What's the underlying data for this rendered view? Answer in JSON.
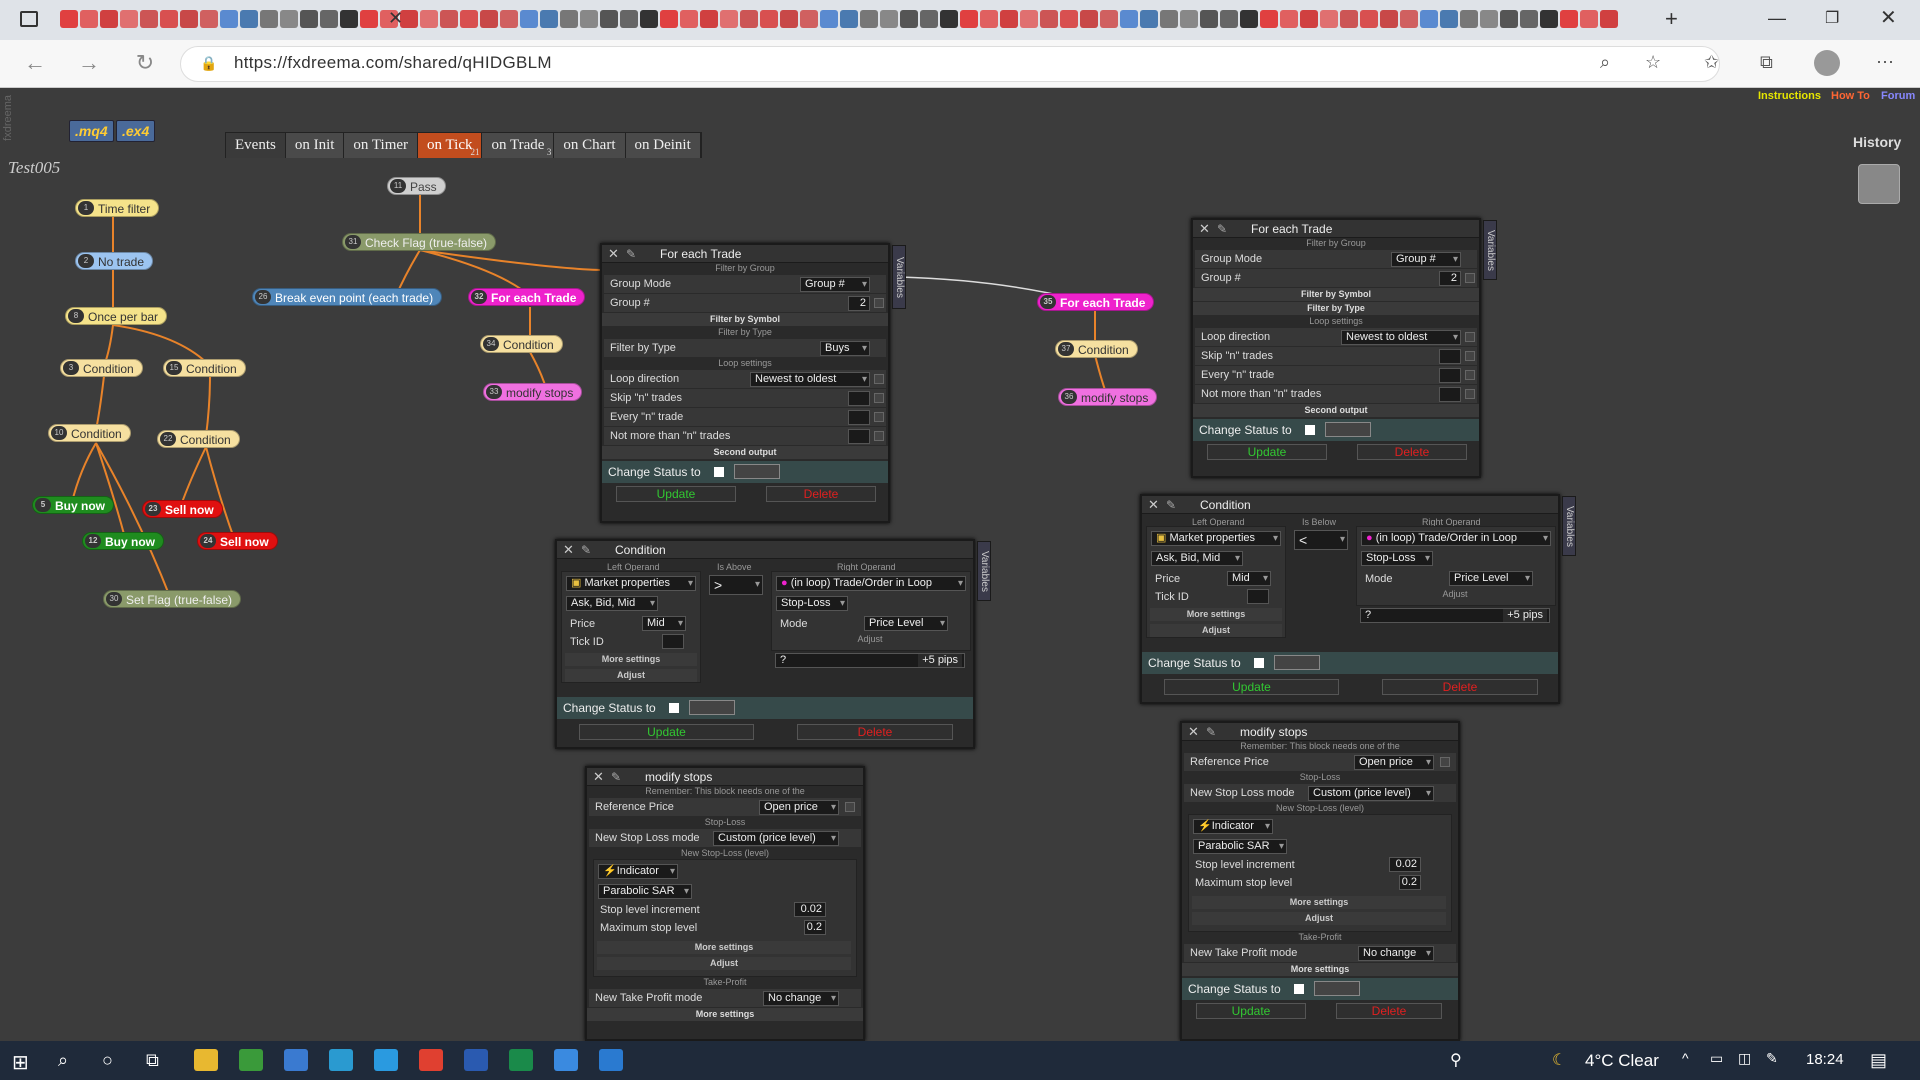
{
  "browser": {
    "url": "https://fxdreema.com/shared/qHIDGBLM"
  },
  "toplinks": {
    "instructions": "Instructions",
    "howto": "How To",
    "forum": "Forum"
  },
  "files": {
    "mq4": ".mq4",
    "ex4": ".ex4"
  },
  "events": {
    "label": "Events",
    "tabs": [
      "on Init",
      "on Timer",
      "on Tick",
      "on Trade",
      "on Chart",
      "on Deinit"
    ],
    "tick_count": "21",
    "trade_count": "3"
  },
  "project": "Test005",
  "side_label": "fxdreema",
  "history": "History",
  "nodes": [
    {
      "num": "1",
      "label": "Time filter"
    },
    {
      "num": "2",
      "label": "No trade"
    },
    {
      "num": "8",
      "label": "Once per bar"
    },
    {
      "num": "3",
      "label": "Condition"
    },
    {
      "num": "15",
      "label": "Condition"
    },
    {
      "num": "10",
      "label": "Condition"
    },
    {
      "num": "22",
      "label": "Condition"
    },
    {
      "num": "5",
      "label": "Buy now"
    },
    {
      "num": "23",
      "label": "Sell now"
    },
    {
      "num": "12",
      "label": "Buy now"
    },
    {
      "num": "24",
      "label": "Sell now"
    },
    {
      "num": "30",
      "label": "Set Flag (true-false)"
    },
    {
      "num": "11",
      "label": "Pass"
    },
    {
      "num": "31",
      "label": "Check Flag (true-false)"
    },
    {
      "num": "26",
      "label": "Break even point (each trade)"
    },
    {
      "num": "32",
      "label": "For each Trade"
    },
    {
      "num": "34",
      "label": "Condition"
    },
    {
      "num": "33",
      "label": "modify stops"
    },
    {
      "num": "35",
      "label": "For each Trade"
    },
    {
      "num": "37",
      "label": "Condition"
    },
    {
      "num": "36",
      "label": "modify stops"
    }
  ],
  "common": {
    "variables": "Variables",
    "filter_by_group": "Filter by Group",
    "group_mode": "Group Mode",
    "group_mode_val": "Group #",
    "group_num": "Group #",
    "group_num_val": "2",
    "filter_by_symbol": "Filter by Symbol",
    "filter_by_type": "Filter by Type",
    "filter_type_val": "Buys",
    "loop_settings": "Loop settings",
    "loop_direction": "Loop direction",
    "loop_dir_val": "Newest to oldest",
    "skip": "Skip \"n\" trades",
    "every": "Every \"n\" trade",
    "notmore": "Not more than \"n\" trades",
    "second_output": "Second output",
    "change_status": "Change Status to",
    "update": "Update",
    "delete": "Delete",
    "left_operand": "Left Operand",
    "right_operand": "Right Operand",
    "is_above": "Is Above",
    "is_below": "Is Below",
    "market_props": "Market properties",
    "ask_bid": "Ask, Bid, Mid",
    "price": "Price",
    "mid": "Mid",
    "tick_id": "Tick ID",
    "more_settings": "More settings",
    "adjust": "Adjust",
    "in_loop": "(in loop) Trade/Order in Loop",
    "stop_loss": "Stop-Loss",
    "mode": "Mode",
    "price_level": "Price Level",
    "q": "?",
    "pips": "+5 pips",
    "gt": ">",
    "lt": "<",
    "remember": "Remember: This block needs one of the",
    "ref_price": "Reference Price",
    "open_price": "Open price",
    "sl_section": "Stop-Loss",
    "new_sl_mode": "New Stop Loss mode",
    "custom_price": "Custom (price level)",
    "new_sl_level": "New Stop-Loss (level)",
    "indicator": "Indicator",
    "psar": "Parabolic SAR",
    "step_inc": "Stop level increment",
    "step_val": "0.02",
    "max_stop": "Maximum stop level",
    "max_val": "0.2",
    "tp_section": "Take-Profit",
    "new_tp_mode": "New Take Profit mode",
    "no_change": "No change"
  },
  "panels": {
    "fet1": "For each Trade",
    "fet2": "For each Trade",
    "cond1": "Condition",
    "cond2": "Condition",
    "ms1": "modify stops",
    "ms2": "modify stops"
  },
  "taskbar": {
    "weather": "4°C  Clear",
    "time": "18:24"
  }
}
